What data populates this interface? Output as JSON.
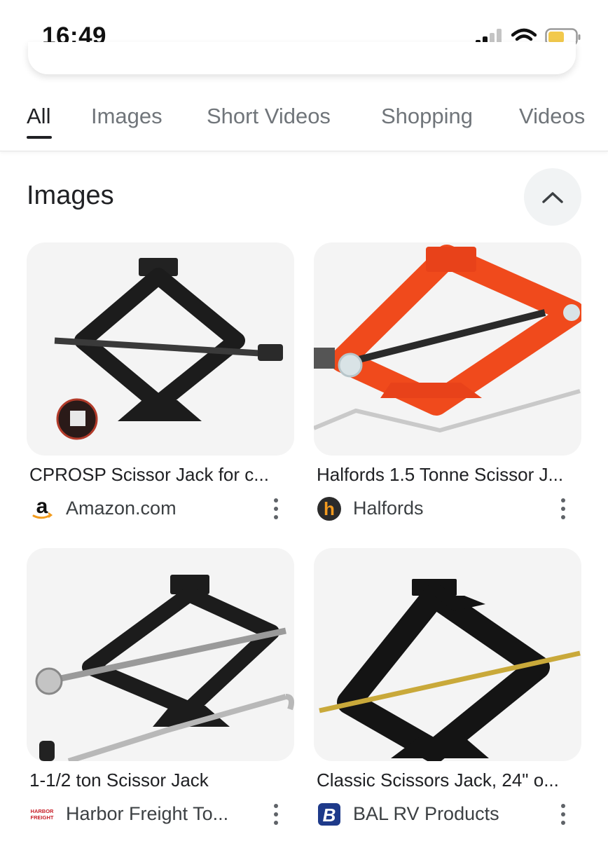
{
  "status_bar": {
    "time": "16:49"
  },
  "tabs": [
    {
      "label": "All",
      "active": true
    },
    {
      "label": "Images",
      "active": false
    },
    {
      "label": "Short Videos",
      "active": false
    },
    {
      "label": "Shopping",
      "active": false
    },
    {
      "label": "Videos",
      "active": false
    }
  ],
  "section": {
    "title": "Images"
  },
  "results": [
    {
      "title": "CPROSP Scissor Jack for c...",
      "source": "Amazon.com",
      "favicon": "amazon-icon",
      "jack_color": "#1c1c1c"
    },
    {
      "title": "Halfords 1.5 Tonne Scissor J...",
      "source": "Halfords",
      "favicon": "halfords-icon",
      "favicon_letter": "h",
      "jack_color": "#f04a1c"
    },
    {
      "title": "1-1/2 ton Scissor Jack",
      "source": "Harbor Freight To...",
      "favicon": "harbor-freight-icon",
      "favicon_text": "HARBOR FREIGHT",
      "jack_color": "#1c1c1c"
    },
    {
      "title": "Classic Scissors Jack, 24\" o...",
      "source": "BAL RV Products",
      "favicon": "bal-icon",
      "favicon_letter": "B",
      "jack_color": "#141414"
    }
  ],
  "colors": {
    "accent_text": "#202124",
    "muted_text": "#70757a",
    "battery": "#f2c94c"
  }
}
